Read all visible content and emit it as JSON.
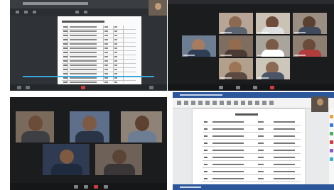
{
  "panels": [
    {
      "name": "screen-share-document"
    },
    {
      "name": "video-grid-6"
    },
    {
      "name": "video-grid-5"
    },
    {
      "name": "word-document"
    }
  ],
  "colors": {
    "share_bg": "#2f3236",
    "video_bg": "#1b1c1e",
    "word_blue": "#2b579a",
    "progress_blue": "#3aa8e0",
    "end_call_red": "#d23b3b"
  }
}
